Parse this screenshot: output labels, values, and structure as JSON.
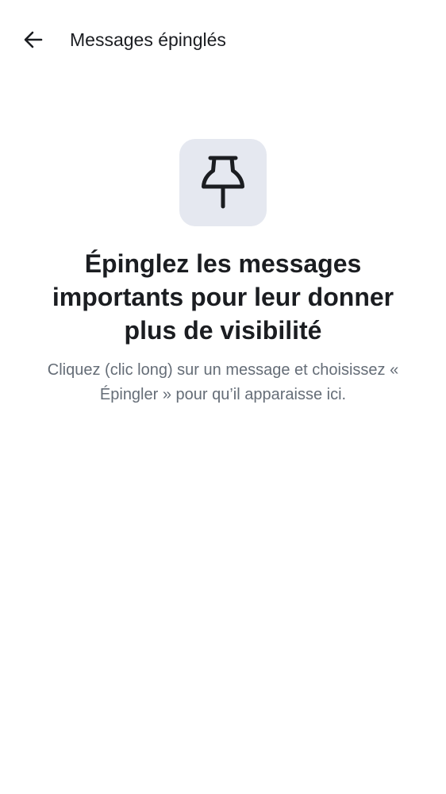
{
  "header": {
    "back_icon": "arrow-left-icon",
    "title": "Messages épinglés"
  },
  "empty_state": {
    "icon": "pin-icon",
    "icon_tile_color": "#e5e8f0",
    "headline": "Épinglez les messages importants pour leur donner plus de visibilité",
    "description": "Cliquez (clic long) sur un message et choisissez « Épingler » pour qu’il apparaisse ici."
  },
  "colors": {
    "background": "#ffffff",
    "text_primary": "#1b1d21",
    "text_secondary": "#656d77"
  }
}
